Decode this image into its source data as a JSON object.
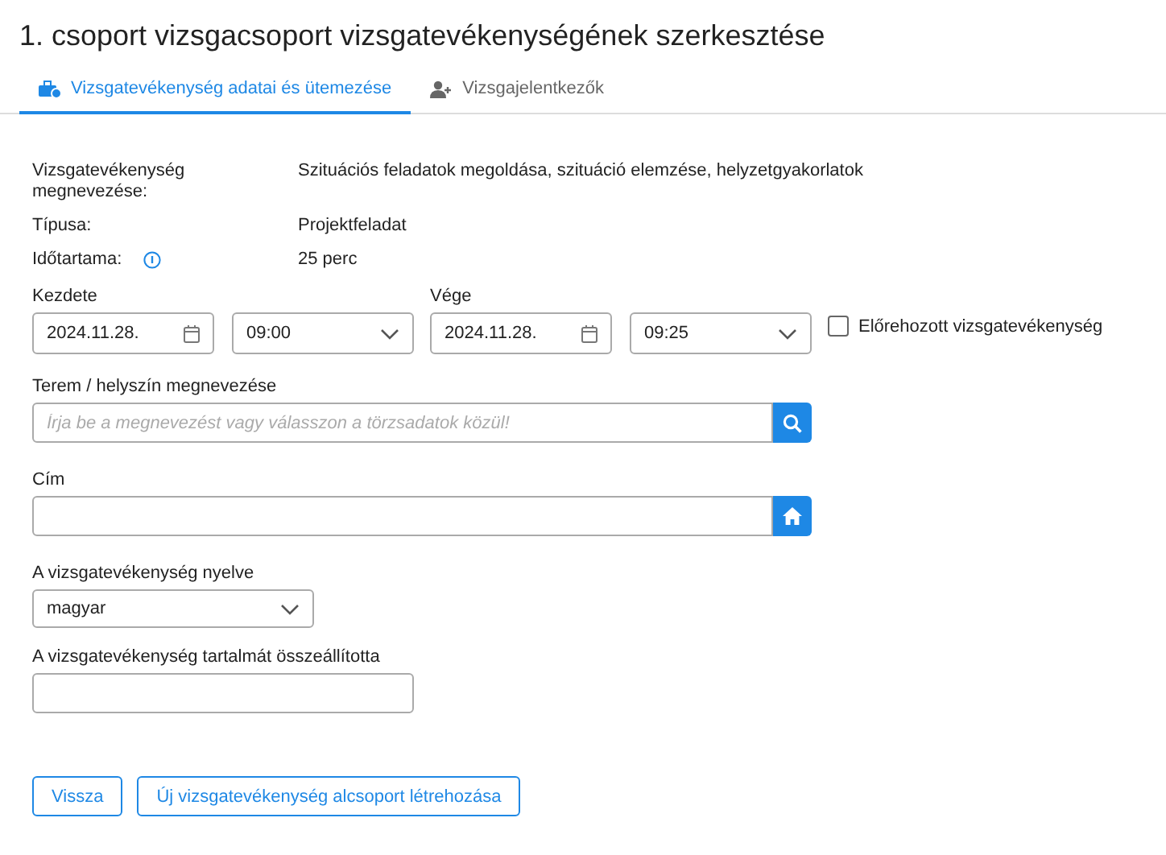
{
  "title": "1. csoport vizsgacsoport vizsgatevékenységének szerkesztése",
  "tabs": [
    {
      "label": "Vizsgatevékenység adatai és ütemezése",
      "selected": true
    },
    {
      "label": "Vizsgajelentkezők",
      "selected": false
    }
  ],
  "info": [
    {
      "label": "Vizsgatevékenység megnevezése:",
      "value": "Szituációs feladatok megoldása, szituáció elemzése, helyzetgyakorlatok",
      "info_icon": false
    },
    {
      "label": "Típusa:",
      "value": "Projektfeladat",
      "info_icon": false
    },
    {
      "label": "Időtartama:",
      "value": "25 perc",
      "info_icon": true
    }
  ],
  "start": {
    "label": "Kezdete",
    "date": "2024.11.28.",
    "time": "09:00"
  },
  "end": {
    "label": "Vége",
    "date": "2024.11.28.",
    "time": "09:25"
  },
  "early": {
    "label": "Előrehozott vizsgatevékenység",
    "checked": false
  },
  "room": {
    "label": "Terem / helyszín megnevezése",
    "placeholder": "Írja be a megnevezést vagy válasszon a törzsadatok közül!"
  },
  "address": {
    "label": "Cím"
  },
  "language": {
    "label": "A vizsgatevékenység nyelve",
    "value": "magyar"
  },
  "author": {
    "label": "A vizsgatevékenység tartalmát összeállította"
  },
  "buttons": [
    "Vissza",
    "Új vizsgatevékenység alcsoport létrehozása"
  ]
}
